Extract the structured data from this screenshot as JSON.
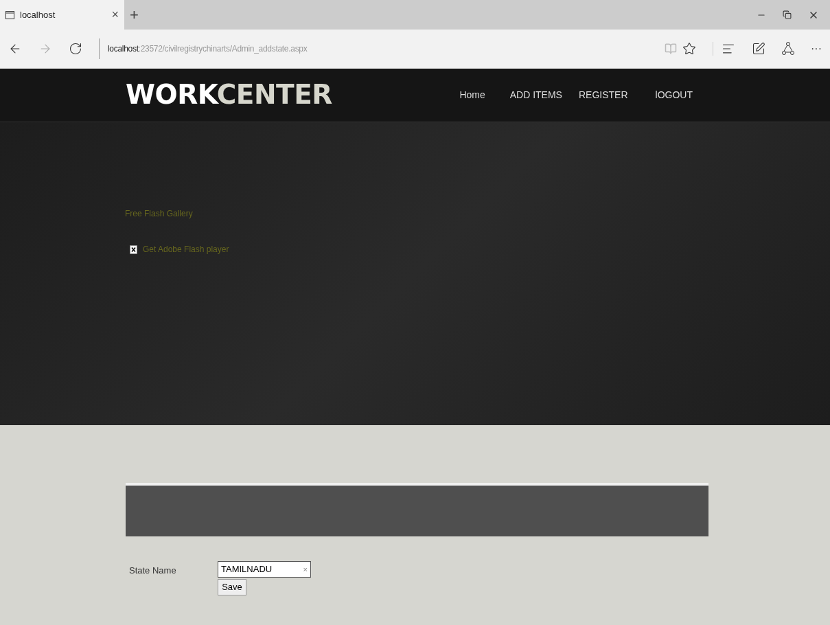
{
  "browser": {
    "tab_title": "localhost",
    "tab_close": "×",
    "new_tab": "+",
    "url_host": "localhost",
    "url_path": ":23572/civilregistrychinarts/Admin_addstate.aspx",
    "more": "···"
  },
  "site": {
    "logo_bold": "WORK",
    "logo_light": "CENTER",
    "nav": [
      {
        "label": "Home"
      },
      {
        "label": "ADD ITEMS"
      },
      {
        "label": "REGISTER"
      },
      {
        "label": "lOGOUT"
      }
    ]
  },
  "hero": {
    "gallery_text": "Free Flash Gallery",
    "flash_link": "Get Adobe Flash player"
  },
  "form": {
    "label": "State Name",
    "value": "TAMILNADU",
    "clear": "×",
    "button": "Save"
  }
}
